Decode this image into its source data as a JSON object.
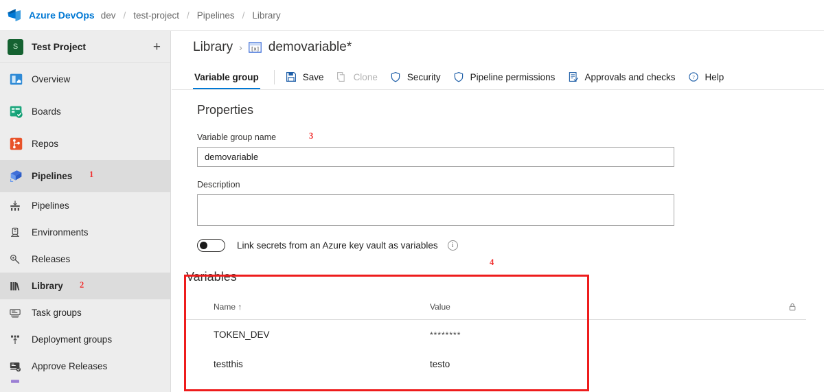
{
  "topbar": {
    "logo_icon": "azure-devops-logo",
    "brand": "Azure DevOps",
    "breadcrumbs": [
      "dev",
      "test-project",
      "Pipelines",
      "Library"
    ],
    "separator": "/"
  },
  "sidebar": {
    "project": {
      "avatar_letter": "S",
      "name": "Test Project",
      "add_label": "+"
    },
    "items": [
      {
        "label": "Overview",
        "icon": "overview-icon",
        "selected": false,
        "sub": false
      },
      {
        "label": "Boards",
        "icon": "boards-icon",
        "selected": false,
        "sub": false
      },
      {
        "label": "Repos",
        "icon": "repos-icon",
        "selected": false,
        "sub": false
      },
      {
        "label": "Pipelines",
        "icon": "pipelines-icon",
        "selected": true,
        "sub": false
      },
      {
        "label": "Pipelines",
        "icon": "pipelines-sub-icon",
        "selected": false,
        "sub": true
      },
      {
        "label": "Environments",
        "icon": "environments-icon",
        "selected": false,
        "sub": true
      },
      {
        "label": "Releases",
        "icon": "releases-icon",
        "selected": false,
        "sub": true
      },
      {
        "label": "Library",
        "icon": "library-icon",
        "selected": true,
        "sub": true
      },
      {
        "label": "Task groups",
        "icon": "task-groups-icon",
        "selected": false,
        "sub": true
      },
      {
        "label": "Deployment groups",
        "icon": "deployment-groups-icon",
        "selected": false,
        "sub": true
      },
      {
        "label": "Approve Releases",
        "icon": "approve-releases-icon",
        "selected": false,
        "sub": true
      }
    ]
  },
  "page": {
    "breadcrumb_root": "Library",
    "breadcrumb_chevron": "›",
    "title": "demovariable*",
    "title_icon": "variable-group-icon"
  },
  "toolbar": {
    "tab_label": "Variable group",
    "buttons": [
      {
        "label": "Save",
        "icon": "save-icon",
        "disabled": false
      },
      {
        "label": "Clone",
        "icon": "clone-icon",
        "disabled": true
      },
      {
        "label": "Security",
        "icon": "shield-icon",
        "disabled": false
      },
      {
        "label": "Pipeline permissions",
        "icon": "shield-outline-icon",
        "disabled": false
      },
      {
        "label": "Approvals and checks",
        "icon": "approvals-checks-icon",
        "disabled": false
      },
      {
        "label": "Help",
        "icon": "help-circle-icon",
        "disabled": false
      }
    ]
  },
  "properties": {
    "heading": "Properties",
    "name_label": "Variable group name",
    "name_value": "demovariable",
    "name_placeholder": "",
    "description_label": "Description",
    "description_value": "",
    "description_placeholder": "",
    "keyvault_toggle_label": "Link secrets from an Azure key vault as variables",
    "keyvault_toggle_on": false,
    "info_icon": "info-icon",
    "info_glyph": "i"
  },
  "variables": {
    "heading": "Variables",
    "columns": {
      "name": "Name ↑",
      "value": "Value",
      "lock": "lock-icon"
    },
    "rows": [
      {
        "name": "TOKEN_DEV",
        "value": "********",
        "secret": true
      },
      {
        "name": "testthis",
        "value": "testo",
        "secret": false
      }
    ]
  },
  "annotations": [
    {
      "number": "1",
      "target": "pipelines-nav-item"
    },
    {
      "number": "2",
      "target": "library-nav-item"
    },
    {
      "number": "3",
      "target": "variable-group-name-field"
    },
    {
      "number": "4",
      "target": "variables-section"
    }
  ],
  "colors": {
    "accent": "#0078d4",
    "annotation_red": "#f03030",
    "highlight_box": "#ee1c1c",
    "sidebar_bg": "#ededed",
    "sidebar_selected": "#dcdcdc",
    "project_avatar": "#156231"
  }
}
